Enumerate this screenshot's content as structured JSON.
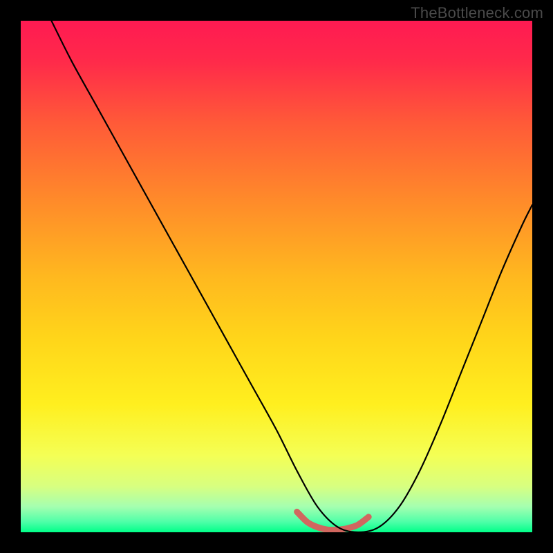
{
  "watermark": "TheBottleneck.com",
  "gradient": {
    "stops": [
      {
        "offset": 0.0,
        "color": "#ff1a52"
      },
      {
        "offset": 0.08,
        "color": "#ff2a4a"
      },
      {
        "offset": 0.2,
        "color": "#ff5a38"
      },
      {
        "offset": 0.35,
        "color": "#ff8a2a"
      },
      {
        "offset": 0.5,
        "color": "#ffb81f"
      },
      {
        "offset": 0.62,
        "color": "#ffd51a"
      },
      {
        "offset": 0.75,
        "color": "#ffef1f"
      },
      {
        "offset": 0.85,
        "color": "#f4ff55"
      },
      {
        "offset": 0.91,
        "color": "#d8ff80"
      },
      {
        "offset": 0.95,
        "color": "#a5ffb0"
      },
      {
        "offset": 0.98,
        "color": "#4dffa8"
      },
      {
        "offset": 1.0,
        "color": "#00ff88"
      }
    ]
  },
  "chart_data": {
    "type": "line",
    "title": "",
    "xlabel": "",
    "ylabel": "",
    "xlim": [
      0,
      100
    ],
    "ylim": [
      0,
      100
    ],
    "note": "Asymmetric V-shaped curve; left branch steeper than right; trough roughly x≈55–68 at y≈0; axis details not visible in image — values estimated from pixel position only.",
    "series": [
      {
        "name": "primary-curve",
        "stroke": "#000000",
        "x": [
          6,
          10,
          15,
          20,
          25,
          30,
          35,
          40,
          45,
          50,
          54,
          58,
          62,
          66,
          70,
          74,
          78,
          82,
          86,
          90,
          94,
          98,
          100
        ],
        "values": [
          100,
          92,
          83,
          74,
          65,
          56,
          47,
          38,
          29,
          20,
          12,
          5,
          1,
          0,
          1,
          5,
          12,
          21,
          31,
          41,
          51,
          60,
          64
        ]
      },
      {
        "name": "valley-highlight",
        "stroke": "#d1675f",
        "x": [
          54,
          56,
          58,
          60,
          62,
          64,
          66,
          68
        ],
        "values": [
          4,
          2,
          1,
          0.5,
          0.5,
          0.8,
          1.5,
          3
        ]
      }
    ]
  }
}
